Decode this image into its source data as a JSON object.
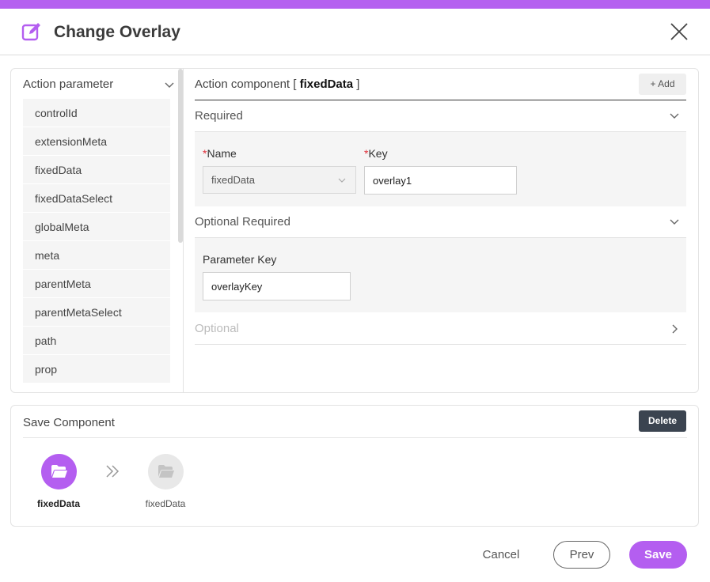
{
  "header": {
    "title": "Change Overlay",
    "icon": "edit-icon",
    "close_icon": "close-icon"
  },
  "colors": {
    "accent": "#b45ef0",
    "dark_button": "#3b4450",
    "required_mark": "#e0303a"
  },
  "action_parameter": {
    "label": "Action parameter",
    "items": [
      "controlId",
      "extensionMeta",
      "fixedData",
      "fixedDataSelect",
      "globalMeta",
      "meta",
      "parentMeta",
      "parentMetaSelect",
      "path",
      "prop"
    ]
  },
  "action_component": {
    "label": "Action component [",
    "name": "fixedData",
    "close_bracket": "]",
    "add_label": "Add"
  },
  "required": {
    "label": "Required",
    "name_label": "Name",
    "name_value": "fixedData",
    "key_label": "Key",
    "key_value": "overlay1",
    "required_mark": "*"
  },
  "optional_required": {
    "label": "Optional Required",
    "param_key_label": "Parameter Key",
    "param_key_value": "overlayKey"
  },
  "optional": {
    "label": "Optional"
  },
  "save_component": {
    "label": "Save Component",
    "delete_label": "Delete",
    "steps": [
      {
        "name": "fixedData",
        "active": true,
        "icon": "folder-open-icon"
      },
      {
        "name": "fixedData",
        "active": false,
        "icon": "folder-open-icon"
      }
    ]
  },
  "footer": {
    "cancel_label": "Cancel",
    "prev_label": "Prev",
    "save_label": "Save"
  }
}
